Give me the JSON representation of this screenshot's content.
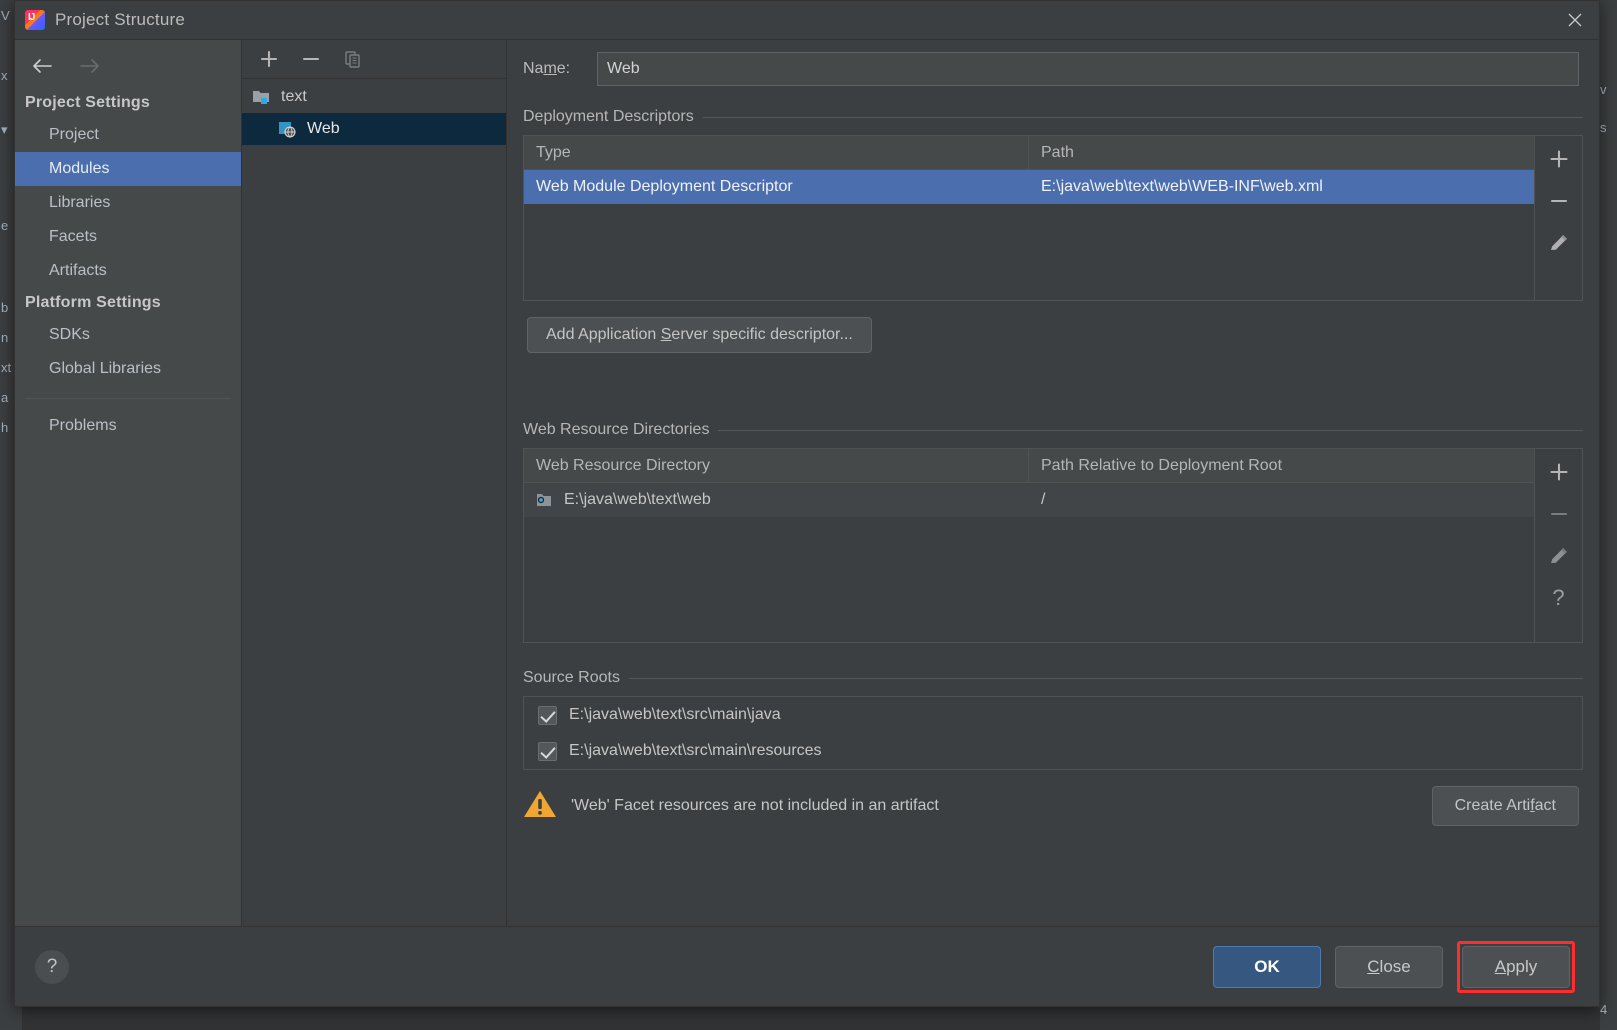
{
  "window": {
    "title": "Project Structure",
    "app_icon": "intellij-idea-icon",
    "close_icon": "close-icon"
  },
  "navigation": {
    "back_icon": "arrow-left-icon",
    "forward_icon": "arrow-right-icon"
  },
  "sidebar": {
    "groups": [
      {
        "header": "Project Settings",
        "items": [
          {
            "label": "Project",
            "selected": false
          },
          {
            "label": "Modules",
            "selected": true
          },
          {
            "label": "Libraries",
            "selected": false
          },
          {
            "label": "Facets",
            "selected": false
          },
          {
            "label": "Artifacts",
            "selected": false
          }
        ]
      },
      {
        "header": "Platform Settings",
        "items": [
          {
            "label": "SDKs",
            "selected": false
          },
          {
            "label": "Global Libraries",
            "selected": false
          }
        ]
      }
    ],
    "problems": {
      "label": "Problems",
      "selected": false
    }
  },
  "modules_panel": {
    "toolbar": [
      {
        "name": "add-module-button",
        "icon": "plus-icon",
        "enabled": true
      },
      {
        "name": "remove-module-button",
        "icon": "minus-icon",
        "enabled": true
      },
      {
        "name": "copy-module-button",
        "icon": "copy-icon",
        "enabled": false
      }
    ],
    "tree": [
      {
        "label": "text",
        "icon": "module-folder-icon",
        "level": 0,
        "selected": false
      },
      {
        "label": "Web",
        "icon": "web-facet-icon",
        "level": 1,
        "selected": true
      }
    ]
  },
  "main": {
    "name_field": {
      "label": "Name:",
      "label_mnemonic": "m",
      "value": "Web",
      "placeholder": ""
    },
    "deployment_descriptors": {
      "title": "Deployment Descriptors",
      "columns": [
        "Type",
        "Path"
      ],
      "rows": [
        {
          "type": "Web Module Deployment Descriptor",
          "path": "E:\\java\\web\\text\\web\\WEB-INF\\web.xml",
          "selected": true
        }
      ],
      "tools": [
        {
          "name": "add-descriptor-button",
          "icon": "plus-icon",
          "enabled": true
        },
        {
          "name": "remove-descriptor-button",
          "icon": "minus-icon",
          "enabled": true
        },
        {
          "name": "edit-descriptor-button",
          "icon": "pencil-icon",
          "enabled": true
        }
      ],
      "add_server_descriptor_button": {
        "label": "Add Application Server specific descriptor...",
        "mnemonic": "S"
      }
    },
    "web_resource_directories": {
      "title": "Web Resource Directories",
      "columns": [
        "Web Resource Directory",
        "Path Relative to Deployment Root"
      ],
      "rows": [
        {
          "directory": "E:\\java\\web\\text\\web",
          "relative_path": "/",
          "icon": "folder-web-icon"
        }
      ],
      "tools": [
        {
          "name": "add-web-resource-button",
          "icon": "plus-icon",
          "enabled": true
        },
        {
          "name": "remove-web-resource-button",
          "icon": "minus-icon",
          "enabled": false
        },
        {
          "name": "edit-web-resource-button",
          "icon": "pencil-icon",
          "enabled": true
        },
        {
          "name": "web-resource-help-button",
          "icon": "question-icon",
          "enabled": true
        }
      ]
    },
    "source_roots": {
      "title": "Source Roots",
      "items": [
        {
          "label": "E:\\java\\web\\text\\src\\main\\java",
          "checked": true
        },
        {
          "label": "E:\\java\\web\\text\\src\\main\\resources",
          "checked": true
        }
      ]
    },
    "warning": {
      "icon": "warning-triangle-icon",
      "text": "'Web' Facet resources are not included in an artifact",
      "action_label": "Create Artifact",
      "action_mnemonic": "f"
    }
  },
  "footer": {
    "help_icon": "question-mark-icon",
    "buttons": [
      {
        "label": "OK",
        "name": "ok-button",
        "primary": true,
        "highlighted": false
      },
      {
        "label": "Close",
        "name": "close-button",
        "primary": false,
        "mnemonic": "C",
        "highlighted": false
      },
      {
        "label": "Apply",
        "name": "apply-button",
        "primary": false,
        "mnemonic": "A",
        "highlighted": true
      }
    ]
  },
  "colors": {
    "dialog_bg": "#3c3f41",
    "sidebar_bg": "#45494a",
    "selection_blue": "#4b6eaf",
    "tree_selection": "#0d293e",
    "primary_button": "#365880",
    "highlight_red": "#ff2d2d",
    "warning_amber": "#f0a732",
    "text_primary": "#c6c6c6"
  },
  "background_window": {
    "left_fragments": [
      "V",
      "x",
      "▾",
      "e",
      "b",
      "n",
      "xt",
      "a",
      "h"
    ],
    "right_fragments": [
      "v",
      "s",
      "4"
    ]
  }
}
